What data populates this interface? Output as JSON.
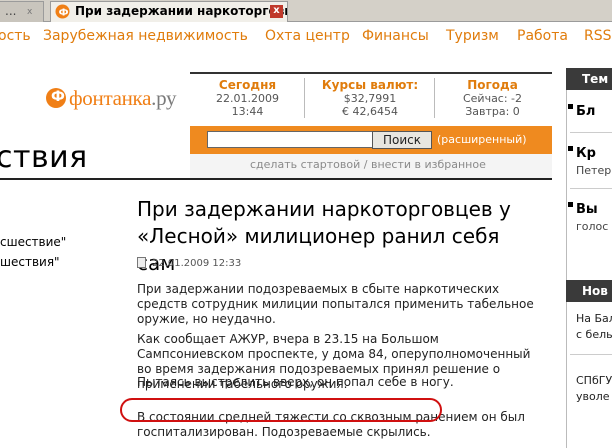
{
  "browser": {
    "inactive_tab": "...",
    "active_tab": "При задержании наркоторговц",
    "close_glyph": "x"
  },
  "nav": {
    "items": [
      "ость",
      "Зарубежная недвижимость",
      "Охта центр",
      "Финансы",
      "Туризм",
      "Работа",
      "RSS"
    ]
  },
  "logo": {
    "prefix": "фонтанка",
    "suffix": ".ру",
    "badge": "Ф"
  },
  "info": {
    "today_label": "Сегодня",
    "today_date": "22.01.2009",
    "today_time": "13:44",
    "rates_label": "Курсы валют:",
    "usd": "$32,7991",
    "eur": "€ 42,6454",
    "weather_label": "Погода",
    "weather_now": "Сейчас: -2",
    "weather_tomorrow": "Завтра: 0"
  },
  "search": {
    "button": "Поиск",
    "extended": "(расширенный)",
    "value": ""
  },
  "startline": "сделать стартовой / внести в избранное",
  "section_title": "ствия",
  "left_links": [
    "сшествие\"",
    "шествия\""
  ],
  "article": {
    "title": "При задержании наркоторговцев у «Лесной» милиционер ранил себя сам",
    "date": "22.01.2009 12:33",
    "paragraphs": [
      "При задержании подозреваемых в сбыте наркотических средств сотрудник милиции попытался применить табельное оружие, но неудачно.",
      "Как сообщает АЖУР, вчера в 23.15 на Большом Сампсониевском проспекте, у дома 84, оперуполномоченный во время задержания подозреваемых принял решение о применении табельного оружия.",
      "Пытаясь выстрелить вверх, он попал себе в ногу.",
      "В состоянии средней тяжести со сквозным ранением он был госпитализирован. Подозреваемые скрылись."
    ]
  },
  "right": {
    "head1": "Тем",
    "b1": "Бл",
    "b2": "Кр",
    "b2sub": "Петер",
    "b3": "Вы",
    "b3sub": "голос",
    "head2": "Нов",
    "t1": "На Бал",
    "t2": "с бель",
    "t3": "СПбГУ",
    "t4": "уволе"
  },
  "colors": {
    "accent": "#ef8a1f",
    "nav": "#e07c0c",
    "highlight": "#d01010"
  }
}
